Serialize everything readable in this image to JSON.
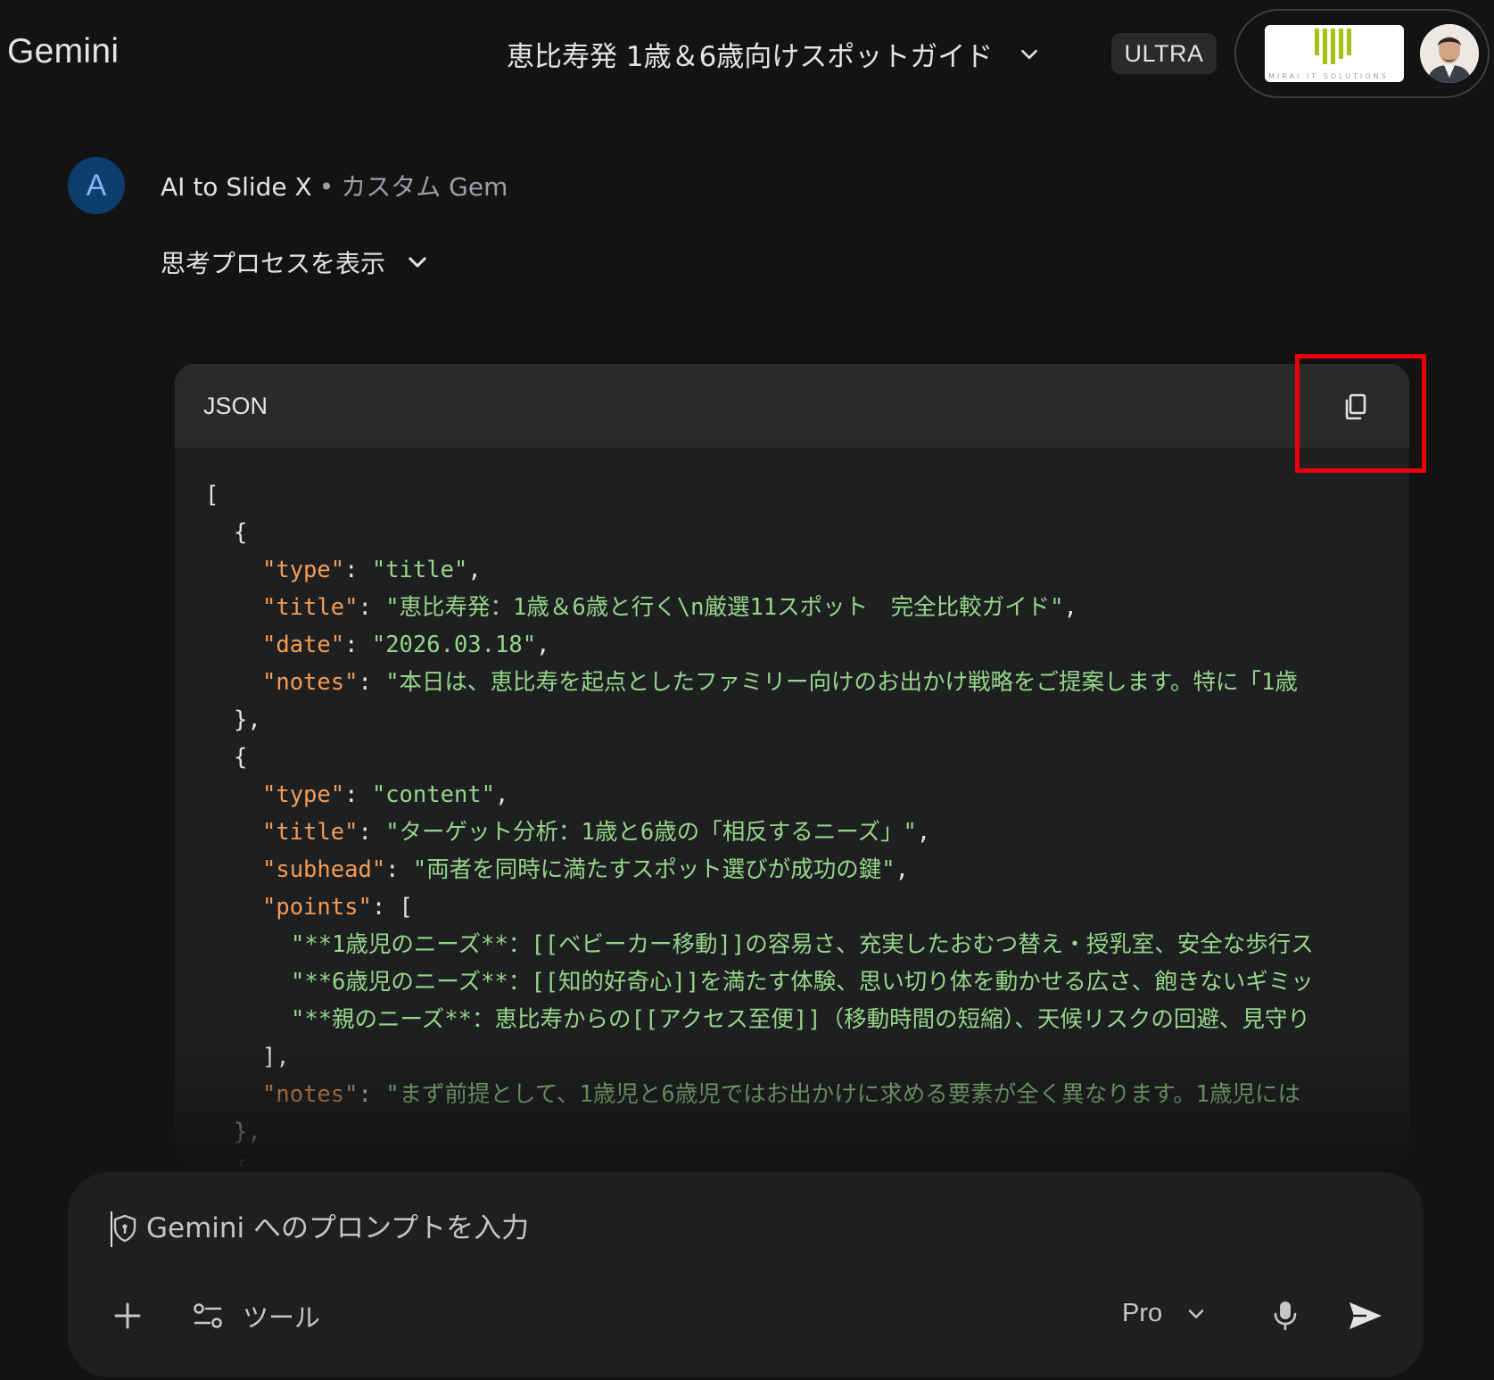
{
  "app": {
    "name": "Gemini"
  },
  "header": {
    "chat_title": "恵比寿発 1歳＆6歳向けスポットガイド",
    "plan_badge": "ULTRA"
  },
  "message": {
    "avatar_letter": "A",
    "gem_name": "AI to Slide X",
    "separator": "•",
    "gem_kind": "カスタム Gem",
    "thinking_toggle": "思考プロセスを表示"
  },
  "code_block": {
    "language": "JSON",
    "copy_icon": "copy-icon",
    "lines": [
      {
        "indent": 0,
        "tokens": [
          {
            "t": "punc",
            "v": "["
          }
        ]
      },
      {
        "indent": 1,
        "tokens": [
          {
            "t": "punc",
            "v": "{"
          }
        ]
      },
      {
        "indent": 2,
        "tokens": [
          {
            "t": "key",
            "v": "\"type\""
          },
          {
            "t": "punc",
            "v": ": "
          },
          {
            "t": "str",
            "v": "\"title\""
          },
          {
            "t": "punc",
            "v": ","
          }
        ]
      },
      {
        "indent": 2,
        "tokens": [
          {
            "t": "key",
            "v": "\"title\""
          },
          {
            "t": "punc",
            "v": ": "
          },
          {
            "t": "str",
            "v": "\"恵比寿発：1歳＆6歳と行く\\n厳選11スポット　完全比較ガイド\""
          },
          {
            "t": "punc",
            "v": ","
          }
        ]
      },
      {
        "indent": 2,
        "tokens": [
          {
            "t": "key",
            "v": "\"date\""
          },
          {
            "t": "punc",
            "v": ": "
          },
          {
            "t": "str",
            "v": "\"2026.03.18\""
          },
          {
            "t": "punc",
            "v": ","
          }
        ]
      },
      {
        "indent": 2,
        "tokens": [
          {
            "t": "key",
            "v": "\"notes\""
          },
          {
            "t": "punc",
            "v": ": "
          },
          {
            "t": "str",
            "v": "\"本日は、恵比寿を起点としたファミリー向けのお出かけ戦略をご提案します。特に「1歳"
          }
        ]
      },
      {
        "indent": 1,
        "tokens": [
          {
            "t": "punc",
            "v": "},"
          }
        ]
      },
      {
        "indent": 1,
        "tokens": [
          {
            "t": "punc",
            "v": "{"
          }
        ]
      },
      {
        "indent": 2,
        "tokens": [
          {
            "t": "key",
            "v": "\"type\""
          },
          {
            "t": "punc",
            "v": ": "
          },
          {
            "t": "str",
            "v": "\"content\""
          },
          {
            "t": "punc",
            "v": ","
          }
        ]
      },
      {
        "indent": 2,
        "tokens": [
          {
            "t": "key",
            "v": "\"title\""
          },
          {
            "t": "punc",
            "v": ": "
          },
          {
            "t": "str",
            "v": "\"ターゲット分析：1歳と6歳の「相反するニーズ」\""
          },
          {
            "t": "punc",
            "v": ","
          }
        ]
      },
      {
        "indent": 2,
        "tokens": [
          {
            "t": "key",
            "v": "\"subhead\""
          },
          {
            "t": "punc",
            "v": ": "
          },
          {
            "t": "str",
            "v": "\"両者を同時に満たすスポット選びが成功の鍵\""
          },
          {
            "t": "punc",
            "v": ","
          }
        ]
      },
      {
        "indent": 2,
        "tokens": [
          {
            "t": "key",
            "v": "\"points\""
          },
          {
            "t": "punc",
            "v": ": ["
          }
        ]
      },
      {
        "indent": 3,
        "tokens": [
          {
            "t": "str",
            "v": "\"**1歳児のニーズ**：[[ベビーカー移動]]の容易さ、充実したおむつ替え・授乳室、安全な歩行ス"
          }
        ]
      },
      {
        "indent": 3,
        "tokens": [
          {
            "t": "str",
            "v": "\"**6歳児のニーズ**：[[知的好奇心]]を満たす体験、思い切り体を動かせる広さ、飽きないギミッ"
          }
        ]
      },
      {
        "indent": 3,
        "tokens": [
          {
            "t": "str",
            "v": "\"**親のニーズ**：恵比寿からの[[アクセス至便]]（移動時間の短縮）、天候リスクの回避、見守り"
          }
        ]
      },
      {
        "indent": 2,
        "tokens": [
          {
            "t": "punc",
            "v": "],"
          }
        ]
      },
      {
        "indent": 2,
        "tokens": [
          {
            "t": "key",
            "v": "\"notes\""
          },
          {
            "t": "punc",
            "v": ": "
          },
          {
            "t": "str",
            "v": "\"まず前提として、1歳児と6歳児ではお出かけに求める要素が全く異なります。1歳児には"
          }
        ]
      },
      {
        "indent": 1,
        "tokens": [
          {
            "t": "punc",
            "v": "},"
          }
        ]
      },
      {
        "indent": 1,
        "tokens": [
          {
            "t": "punc",
            "v": "{"
          }
        ]
      }
    ]
  },
  "prompt": {
    "placeholder": "Gemini へのプロンプトを入力",
    "tools_label": "ツール",
    "model_label": "Pro"
  },
  "colors": {
    "background": "#131314",
    "code_key": "#f59b55",
    "code_string": "#96d68a",
    "highlight": "#e8000b",
    "gem_avatar": "#0d3e6e"
  }
}
